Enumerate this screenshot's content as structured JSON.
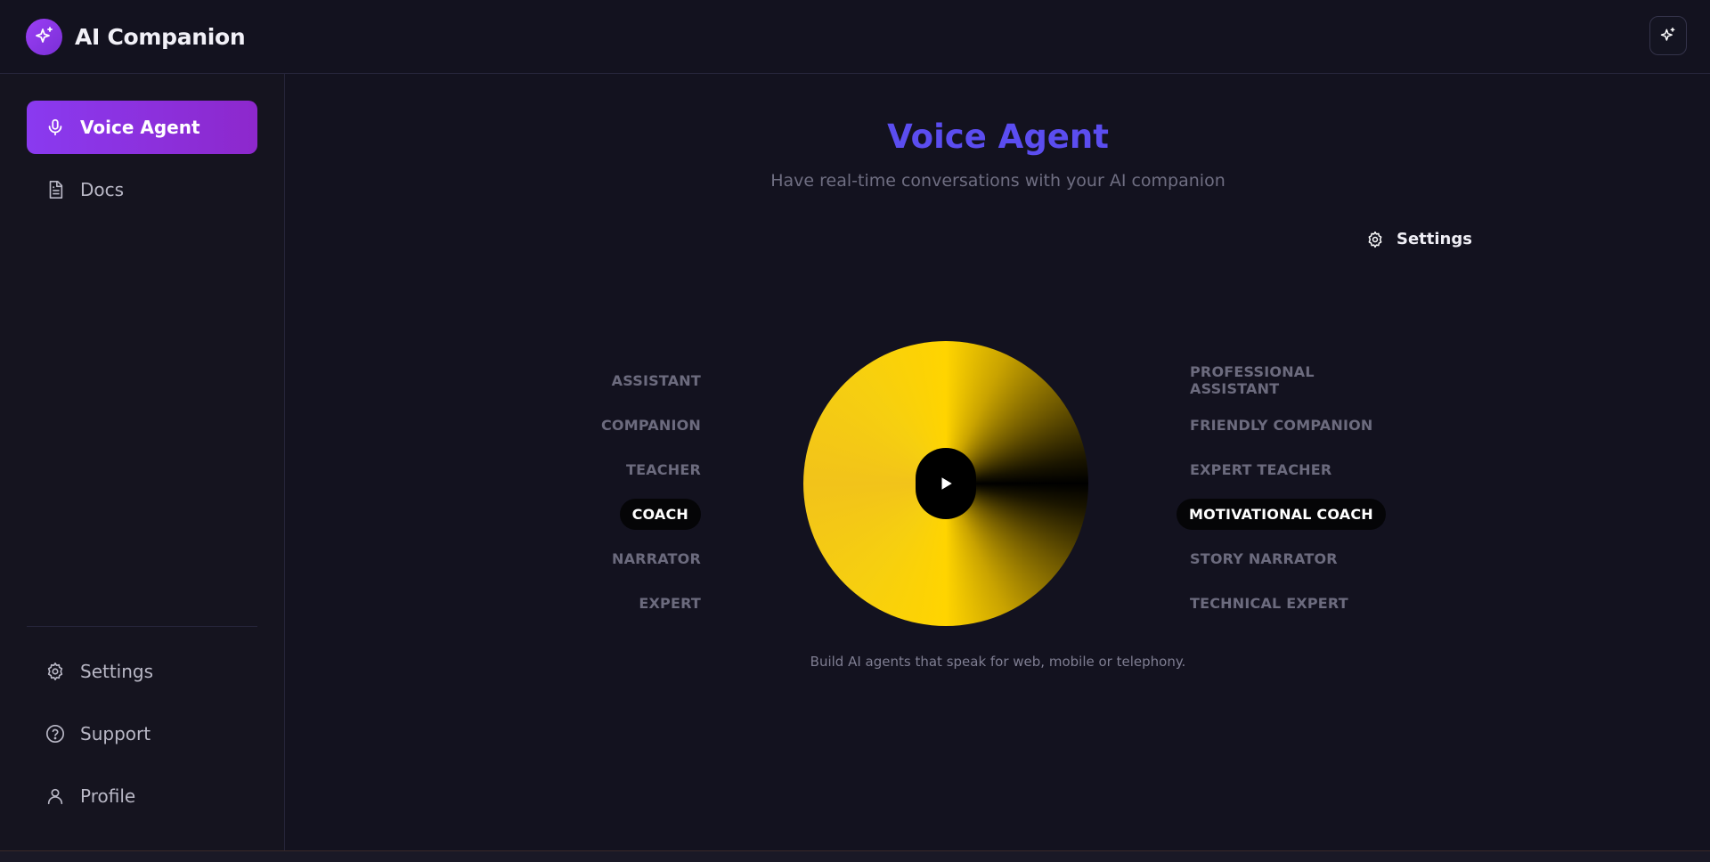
{
  "app": {
    "title": "AI Companion",
    "logo_icon": "sparkles-icon",
    "top_action_icon": "sparkles-icon"
  },
  "sidebar": {
    "items": [
      {
        "label": "Voice Agent",
        "icon": "microphone-icon",
        "active": true
      },
      {
        "label": "Docs",
        "icon": "document-icon",
        "active": false
      }
    ],
    "bottom_items": [
      {
        "label": "Settings",
        "icon": "gear-icon"
      },
      {
        "label": "Support",
        "icon": "help-circle-icon"
      },
      {
        "label": "Profile",
        "icon": "user-icon"
      }
    ]
  },
  "main": {
    "title": "Voice Agent",
    "subtitle": "Have real-time conversations with your AI companion",
    "settings_label": "Settings",
    "roles_short": [
      "ASSISTANT",
      "COMPANION",
      "TEACHER",
      "COACH",
      "NARRATOR",
      "EXPERT"
    ],
    "roles_long": [
      "PROFESSIONAL ASSISTANT",
      "FRIENDLY COMPANION",
      "EXPERT TEACHER",
      "MOTIVATIONAL COACH",
      "STORY NARRATOR",
      "TECHNICAL EXPERT"
    ],
    "selected_role": "COACH",
    "selected_role_long": "MOTIVATIONAL COACH",
    "caption": "Build AI agents that speak for web, mobile or telephony."
  },
  "colors": {
    "accent": "#8a3af0",
    "title": "#5b4df0",
    "orb": "#ffd400",
    "background": "#13121f"
  }
}
